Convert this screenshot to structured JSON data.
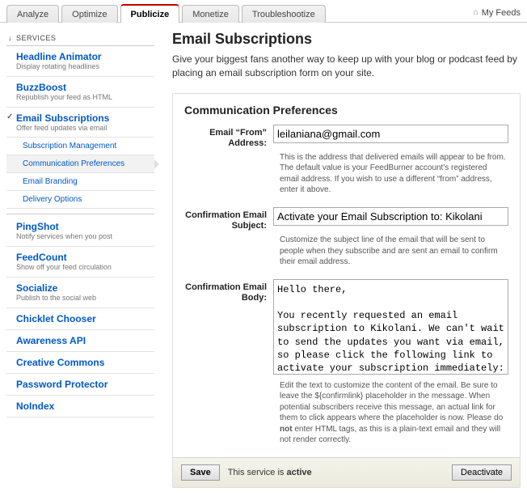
{
  "tabs": {
    "items": [
      "Analyze",
      "Optimize",
      "Publicize",
      "Monetize",
      "Troubleshootize"
    ],
    "activeIndex": 2,
    "myFeeds": "My Feeds"
  },
  "sidebar": {
    "header": "SERVICES",
    "items": [
      {
        "title": "Headline Animator",
        "desc": "Display rotating headlines"
      },
      {
        "title": "BuzzBoost",
        "desc": "Republish your feed as HTML"
      },
      {
        "title": "Email Subscriptions",
        "desc": "Offer feed updates via email",
        "checked": true
      },
      {
        "title": "Subscription Management",
        "sub": true
      },
      {
        "title": "Communication Preferences",
        "sub": true,
        "active": true
      },
      {
        "title": "Email Branding",
        "sub": true
      },
      {
        "title": "Delivery Options",
        "sub": true
      },
      {
        "title": "PingShot",
        "desc": "Notify services when you post",
        "sepTop": true
      },
      {
        "title": "FeedCount",
        "desc": "Show off your feed circulation"
      },
      {
        "title": "Socialize",
        "desc": "Publish to the social web"
      },
      {
        "title": "Chicklet Chooser"
      },
      {
        "title": "Awareness API"
      },
      {
        "title": "Creative Commons"
      },
      {
        "title": "Password Protector"
      },
      {
        "title": "NoIndex"
      }
    ]
  },
  "main": {
    "title": "Email Subscriptions",
    "intro": "Give your biggest fans another way to keep up with your blog or podcast feed by placing an email subscription form on your site.",
    "panelTitle": "Communication Preferences",
    "fields": {
      "from": {
        "label1": "Email “From”",
        "label2": "Address:",
        "value": "leilaniana@gmail.com",
        "help": "This is the address that delivered emails will appear to be from. The default value is your FeedBurner account's registered email address. If you wish to use a different “from” address, enter it above."
      },
      "subject": {
        "label1": "Confirmation Email",
        "label2": "Subject:",
        "value": "Activate your Email Subscription to: Kikolani",
        "help": "Customize the subject line of the email that will be sent to people when they subscribe and are sent an email to confirm their email address."
      },
      "body": {
        "label1": "Confirmation Email",
        "label2": "Body:",
        "value": "Hello there,\n\nYou recently requested an email subscription to Kikolani. We can't wait to send the updates you want via email, so please click the following link to activate your subscription immediately:",
        "help1": "Edit the text to customize the content of the email. Be sure to leave the ${confirmlink} placeholder in the message. When potential subscribers receive this message, an actual link for them to click appears where the placeholder is now. Please do ",
        "helpBold": "not",
        "help2": " enter HTML tags, as this is a plain-text email and they will not render correctly."
      }
    },
    "footer": {
      "save": "Save",
      "status1": "This service is ",
      "statusBold": "active",
      "deactivate": "Deactivate"
    }
  }
}
